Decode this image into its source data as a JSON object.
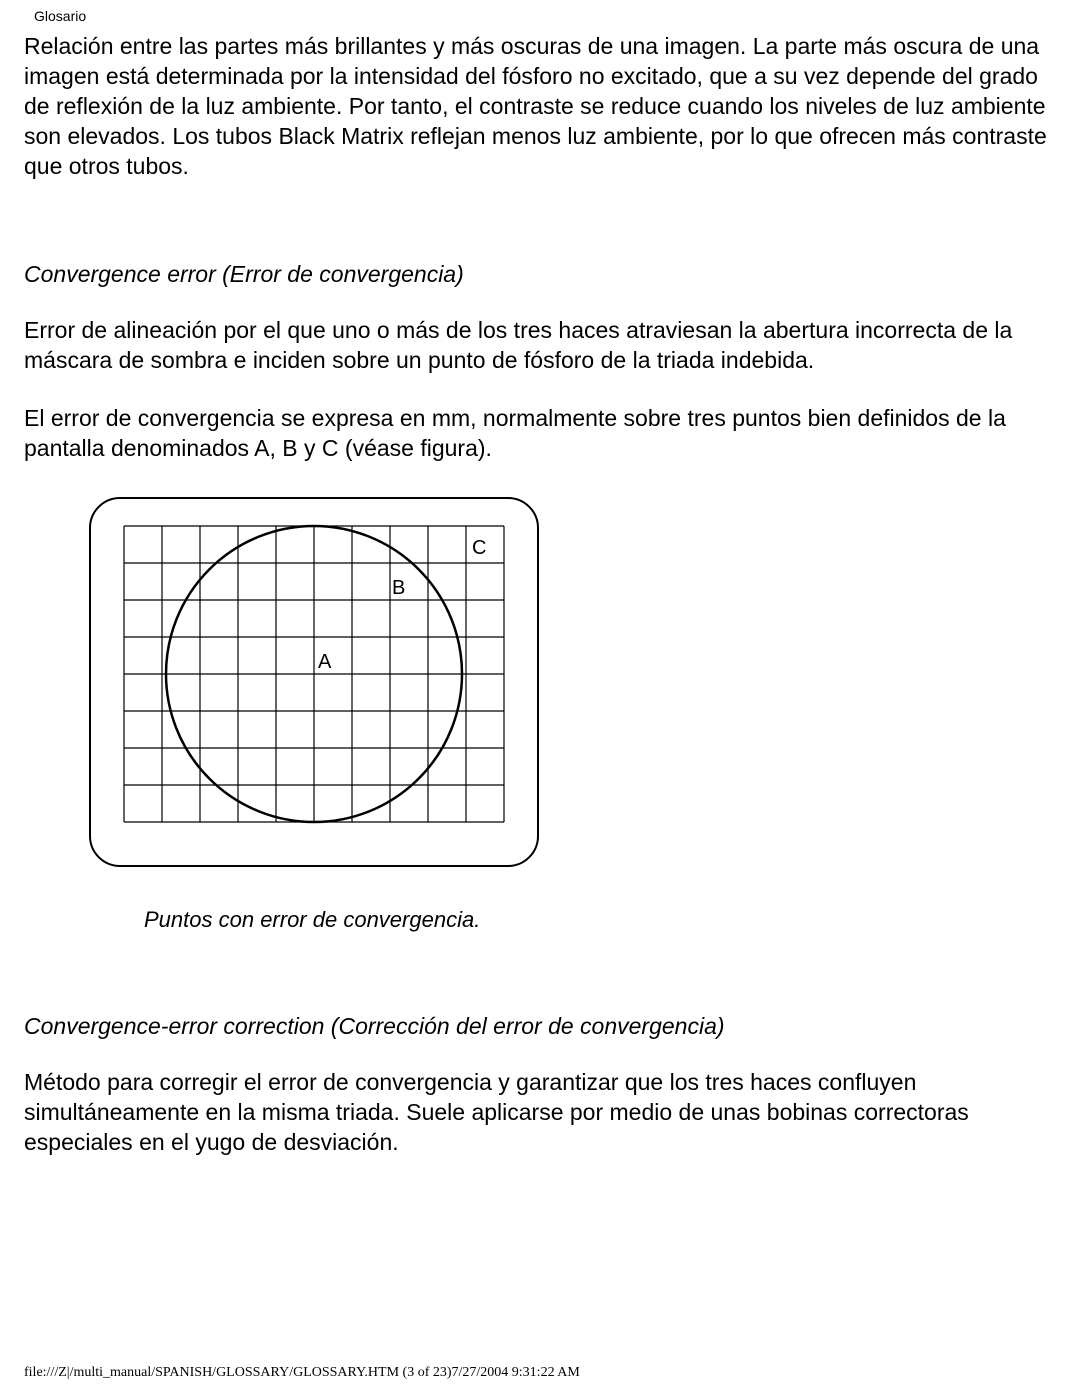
{
  "header": {
    "title": "Glosario"
  },
  "intro_paragraph": "Relación entre las partes más brillantes y más oscuras de una imagen. La parte más oscura de una imagen está determinada por la intensidad del fósforo no excitado, que a su vez depende del grado de reflexión de la luz ambiente. Por tanto, el contraste se reduce cuando los niveles de luz ambiente son elevados. Los tubos Black Matrix reflejan menos luz ambiente, por lo que ofrecen más contraste que otros tubos.",
  "sections": {
    "convergence_error": {
      "heading": "Convergence error (Error de convergencia)",
      "p1": "Error de alineación por el que uno o más de los tres haces atraviesan la abertura incorrecta de la máscara de sombra e inciden sobre un punto de fósforo de la triada indebida.",
      "p2": "El error de convergencia se expresa en mm, normalmente sobre tres puntos bien definidos de la pantalla denominados A, B y C (véase figura).",
      "figure": {
        "caption": "Puntos con error de convergencia.",
        "labels": {
          "A": "A",
          "B": "B",
          "C": "C"
        }
      }
    },
    "convergence_error_correction": {
      "heading": "Convergence-error correction (Corrección del error de convergencia)",
      "p1": "Método para corregir el error de convergencia y garantizar que los tres haces confluyen simultáneamente en la misma triada. Suele aplicarse por medio de unas bobinas correctoras especiales en el yugo de desviación."
    }
  },
  "footer": {
    "text": "file:///Z|/multi_manual/SPANISH/GLOSSARY/GLOSSARY.HTM (3 of 23)7/27/2004 9:31:22 AM"
  }
}
